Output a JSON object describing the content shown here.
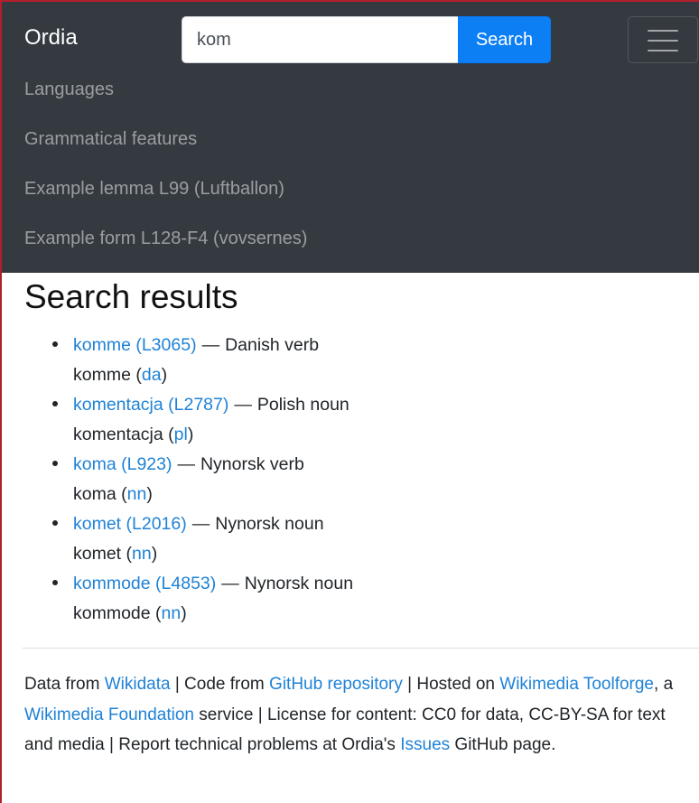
{
  "navbar": {
    "brand": "Ordia",
    "search": {
      "value": "kom",
      "button_label": "Search"
    },
    "links": [
      "Languages",
      "Grammatical features",
      "Example lemma L99 (Luftballon)",
      "Example form L128-F4 (vovsernes)"
    ]
  },
  "main": {
    "title": "Search results",
    "results": [
      {
        "link": "komme (L3065)",
        "desc": "Danish verb",
        "lemma": "komme",
        "lang": "da"
      },
      {
        "link": "komentacja (L2787)",
        "desc": "Polish noun",
        "lemma": "komentacja",
        "lang": "pl"
      },
      {
        "link": "koma (L923)",
        "desc": "Nynorsk verb",
        "lemma": "koma",
        "lang": "nn"
      },
      {
        "link": "komet (L2016)",
        "desc": "Nynorsk noun",
        "lemma": "komet",
        "lang": "nn"
      },
      {
        "link": "kommode (L4853)",
        "desc": "Nynorsk noun",
        "lemma": "kommode",
        "lang": "nn"
      }
    ],
    "dash": "—",
    "paren_open": "(",
    "paren_close": ")"
  },
  "footer": {
    "t1": "Data from ",
    "wikidata": "Wikidata",
    "t2": " | Code from ",
    "github": "GitHub repository",
    "t3": " | Hosted on ",
    "toolforge": "Wikimedia Toolforge",
    "t4": ", a ",
    "foundation": "Wikimedia Foundation",
    "t5": " service | License for content: CC0 for data, CC-BY-SA for text and media | Report technical problems at Ordia's ",
    "issues": "Issues",
    "t6": " GitHub page."
  },
  "colors": {
    "navbar_bg": "#343a40",
    "link": "#1f82d6",
    "search_button": "#0d7ff5",
    "frame": "#b21f2d"
  },
  "icons": {
    "toggler": "hamburger-menu-icon"
  }
}
